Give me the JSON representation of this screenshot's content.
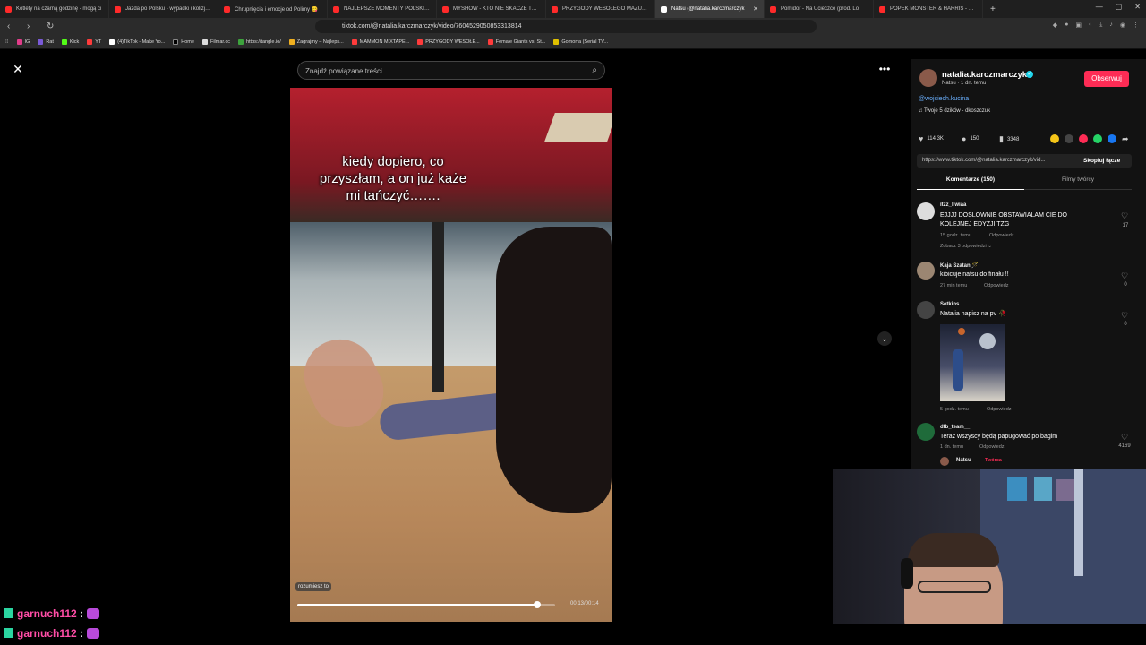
{
  "browser": {
    "tabs": [
      {
        "label": "Kotlety na czarną godzinę - mogą ci"
      },
      {
        "label": "Jazda po Polsku - wypadki i kolizje d"
      },
      {
        "label": "Chrupnięcia i emocje od Polimy 😋"
      },
      {
        "label": "NAJLEPSZE MOMENTY POLSKIEGO"
      },
      {
        "label": "MYSHOW - KTO NIE SKACZE TEN Z"
      },
      {
        "label": "PRZYGODY WESOŁEGO MAZURA wc"
      },
      {
        "label": "Natsu (@natalia.karczmarczyk",
        "active": true
      },
      {
        "label": "Pomidor - Na Ucieczce (prod. Lo"
      },
      {
        "label": "POPEK MONSTER & HARRIS - MON"
      }
    ],
    "url": "tiktok.com/@natalia.karczmarczyk/video/7604529050853313814",
    "bookmarks": [
      "IG",
      "Rat",
      "Kick",
      "YT",
      "(4)TikTok - Make Yo...",
      "Home",
      "Filmar.cc",
      "https://tangle.io/",
      "Zagrajmy – Najleps...",
      "MAMMON MIXTAPE...",
      "PRZYGODY WESOŁE...",
      "Female Giants vs. St...",
      "Gomorra (Serial TV..."
    ]
  },
  "search": {
    "placeholder": "Znajdź powiązane treści"
  },
  "video": {
    "caption": "kiedy dopiero, co przyszłam, a on już każe mi tańczyć…….",
    "sound_label": "rozumiesz to",
    "timecode": "00:13/00:14",
    "progress": 0.93
  },
  "creator": {
    "username": "natalia.karczmarczyk",
    "subtitle": "Natsu · 1 dn. temu",
    "follow_label": "Obserwuj",
    "mention": "@wojciech.kucina",
    "music": "♫  Twoje 5 dzików - dkoszczuk"
  },
  "stats": {
    "likes": "114.3K",
    "comments": "150",
    "saves": "3348"
  },
  "share": {
    "link": "https://www.tiktok.com/@natalia.karczmarczyk/vid...",
    "copy_label": "Skopiuj łącze",
    "colors": [
      "#f5c518",
      "#444444",
      "#fe2c55",
      "#25d366",
      "#1877f2"
    ]
  },
  "tabs": {
    "comments": "Komentarze (150)",
    "videos": "Filmy twórcy"
  },
  "comments": [
    {
      "user": "itzz_liwiaa",
      "text": "EJJJJ DOSLOWNIE OBSTAWIALAM CIE DO KOLEJNEJ EDYZJI TZG",
      "time": "15 godz. temu",
      "reply": "Odpowiedz",
      "likes": "17",
      "more": "Zobacz 3 odpowiedzi ⌄"
    },
    {
      "user": "Kaja Szatan 🪄",
      "text": "kibicuje natsu do finału !!",
      "time": "27 min temu",
      "reply": "Odpowiedz",
      "likes": "0"
    },
    {
      "user": "Setkins",
      "text": "Natalia napisz na pv 🥀",
      "time": "5 godz. temu",
      "reply": "Odpowiedz",
      "likes": "0"
    },
    {
      "user": "dfb_team__",
      "text": "Teraz wszyscy będą papugować po bagim",
      "time": "1 dn. temu",
      "reply": "Odpowiedz",
      "likes": "4169"
    }
  ],
  "reply_preview": {
    "user": "Natsu",
    "badge": "Twórca"
  },
  "chat": [
    {
      "user": "garnuch112",
      "sep": ":"
    },
    {
      "user": "garnuch112",
      "sep": ":"
    }
  ]
}
